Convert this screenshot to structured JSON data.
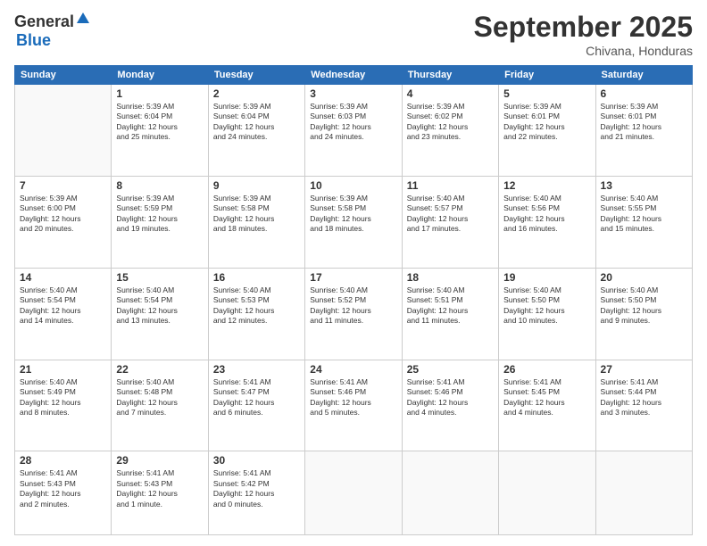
{
  "header": {
    "logo_general": "General",
    "logo_blue": "Blue",
    "month_title": "September 2025",
    "subtitle": "Chivana, Honduras"
  },
  "days_of_week": [
    "Sunday",
    "Monday",
    "Tuesday",
    "Wednesday",
    "Thursday",
    "Friday",
    "Saturday"
  ],
  "weeks": [
    [
      {
        "day": "",
        "info": ""
      },
      {
        "day": "1",
        "info": "Sunrise: 5:39 AM\nSunset: 6:04 PM\nDaylight: 12 hours\nand 25 minutes."
      },
      {
        "day": "2",
        "info": "Sunrise: 5:39 AM\nSunset: 6:04 PM\nDaylight: 12 hours\nand 24 minutes."
      },
      {
        "day": "3",
        "info": "Sunrise: 5:39 AM\nSunset: 6:03 PM\nDaylight: 12 hours\nand 24 minutes."
      },
      {
        "day": "4",
        "info": "Sunrise: 5:39 AM\nSunset: 6:02 PM\nDaylight: 12 hours\nand 23 minutes."
      },
      {
        "day": "5",
        "info": "Sunrise: 5:39 AM\nSunset: 6:01 PM\nDaylight: 12 hours\nand 22 minutes."
      },
      {
        "day": "6",
        "info": "Sunrise: 5:39 AM\nSunset: 6:01 PM\nDaylight: 12 hours\nand 21 minutes."
      }
    ],
    [
      {
        "day": "7",
        "info": "Sunrise: 5:39 AM\nSunset: 6:00 PM\nDaylight: 12 hours\nand 20 minutes."
      },
      {
        "day": "8",
        "info": "Sunrise: 5:39 AM\nSunset: 5:59 PM\nDaylight: 12 hours\nand 19 minutes."
      },
      {
        "day": "9",
        "info": "Sunrise: 5:39 AM\nSunset: 5:58 PM\nDaylight: 12 hours\nand 18 minutes."
      },
      {
        "day": "10",
        "info": "Sunrise: 5:39 AM\nSunset: 5:58 PM\nDaylight: 12 hours\nand 18 minutes."
      },
      {
        "day": "11",
        "info": "Sunrise: 5:40 AM\nSunset: 5:57 PM\nDaylight: 12 hours\nand 17 minutes."
      },
      {
        "day": "12",
        "info": "Sunrise: 5:40 AM\nSunset: 5:56 PM\nDaylight: 12 hours\nand 16 minutes."
      },
      {
        "day": "13",
        "info": "Sunrise: 5:40 AM\nSunset: 5:55 PM\nDaylight: 12 hours\nand 15 minutes."
      }
    ],
    [
      {
        "day": "14",
        "info": "Sunrise: 5:40 AM\nSunset: 5:54 PM\nDaylight: 12 hours\nand 14 minutes."
      },
      {
        "day": "15",
        "info": "Sunrise: 5:40 AM\nSunset: 5:54 PM\nDaylight: 12 hours\nand 13 minutes."
      },
      {
        "day": "16",
        "info": "Sunrise: 5:40 AM\nSunset: 5:53 PM\nDaylight: 12 hours\nand 12 minutes."
      },
      {
        "day": "17",
        "info": "Sunrise: 5:40 AM\nSunset: 5:52 PM\nDaylight: 12 hours\nand 11 minutes."
      },
      {
        "day": "18",
        "info": "Sunrise: 5:40 AM\nSunset: 5:51 PM\nDaylight: 12 hours\nand 11 minutes."
      },
      {
        "day": "19",
        "info": "Sunrise: 5:40 AM\nSunset: 5:50 PM\nDaylight: 12 hours\nand 10 minutes."
      },
      {
        "day": "20",
        "info": "Sunrise: 5:40 AM\nSunset: 5:50 PM\nDaylight: 12 hours\nand 9 minutes."
      }
    ],
    [
      {
        "day": "21",
        "info": "Sunrise: 5:40 AM\nSunset: 5:49 PM\nDaylight: 12 hours\nand 8 minutes."
      },
      {
        "day": "22",
        "info": "Sunrise: 5:40 AM\nSunset: 5:48 PM\nDaylight: 12 hours\nand 7 minutes."
      },
      {
        "day": "23",
        "info": "Sunrise: 5:41 AM\nSunset: 5:47 PM\nDaylight: 12 hours\nand 6 minutes."
      },
      {
        "day": "24",
        "info": "Sunrise: 5:41 AM\nSunset: 5:46 PM\nDaylight: 12 hours\nand 5 minutes."
      },
      {
        "day": "25",
        "info": "Sunrise: 5:41 AM\nSunset: 5:46 PM\nDaylight: 12 hours\nand 4 minutes."
      },
      {
        "day": "26",
        "info": "Sunrise: 5:41 AM\nSunset: 5:45 PM\nDaylight: 12 hours\nand 4 minutes."
      },
      {
        "day": "27",
        "info": "Sunrise: 5:41 AM\nSunset: 5:44 PM\nDaylight: 12 hours\nand 3 minutes."
      }
    ],
    [
      {
        "day": "28",
        "info": "Sunrise: 5:41 AM\nSunset: 5:43 PM\nDaylight: 12 hours\nand 2 minutes."
      },
      {
        "day": "29",
        "info": "Sunrise: 5:41 AM\nSunset: 5:43 PM\nDaylight: 12 hours\nand 1 minute."
      },
      {
        "day": "30",
        "info": "Sunrise: 5:41 AM\nSunset: 5:42 PM\nDaylight: 12 hours\nand 0 minutes."
      },
      {
        "day": "",
        "info": ""
      },
      {
        "day": "",
        "info": ""
      },
      {
        "day": "",
        "info": ""
      },
      {
        "day": "",
        "info": ""
      }
    ]
  ]
}
